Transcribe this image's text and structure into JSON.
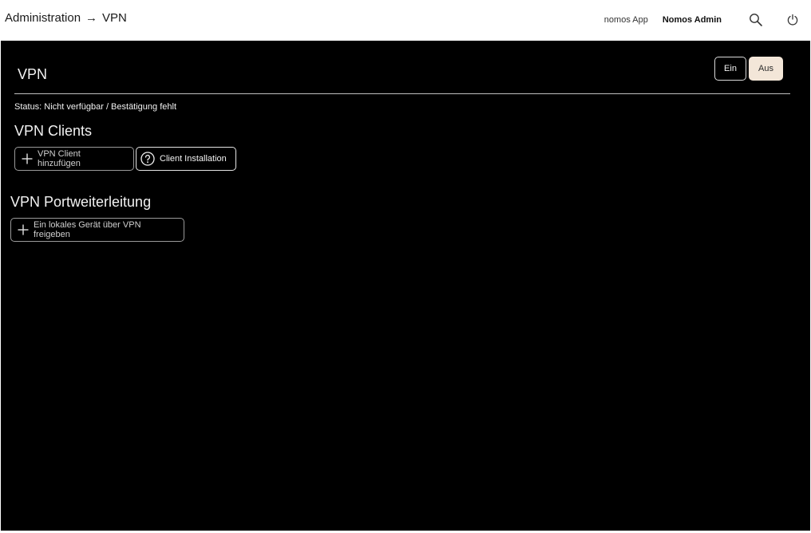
{
  "header": {
    "breadcrumb": [
      "Administration",
      "VPN"
    ],
    "breadcrumb_separator": "→",
    "app_link": "nomos App",
    "user": "Nomos Admin",
    "icons": [
      "search-icon",
      "power-icon"
    ]
  },
  "page": {
    "title": "VPN",
    "toggle": {
      "on_label": "Ein",
      "off_label": "Aus",
      "selected": "Aus"
    },
    "status": "Status:  Nicht verfügbar / Bestätigung fehlt"
  },
  "clients": {
    "title": "VPN Clients",
    "add_label": "VPN Client hinzufügen",
    "install_label": "Client Installation"
  },
  "port_forwarding": {
    "title": "VPN Portweiterleitung",
    "add_label": "Ein lokales Gerät über VPN freigeben"
  },
  "colors": {
    "background": "#000000",
    "accent": "#f3e6d8",
    "text": "#f2f2f2"
  }
}
